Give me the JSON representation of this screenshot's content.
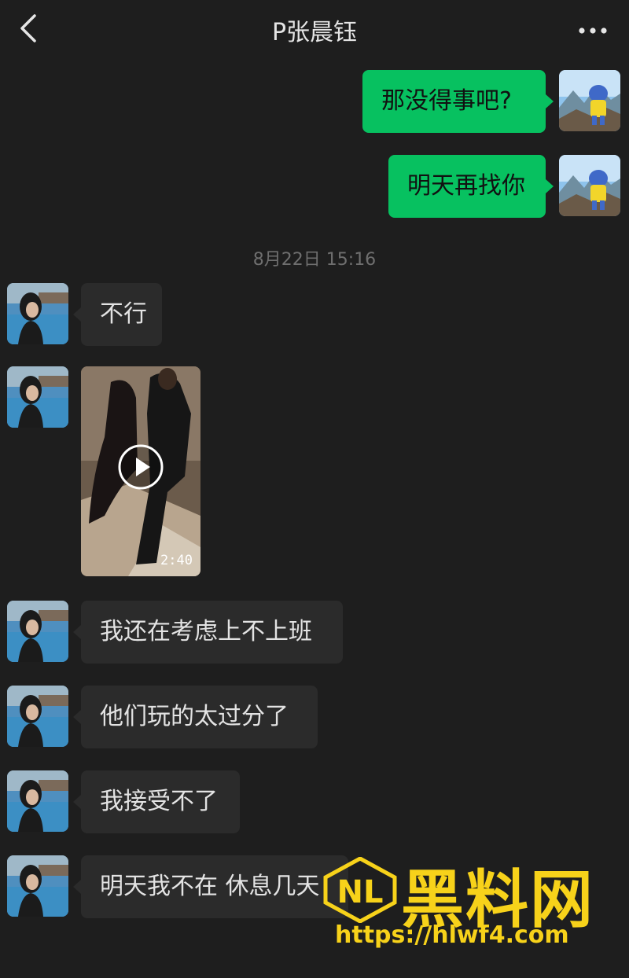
{
  "header": {
    "title": "P张晨钰",
    "back_icon": "chevron-left-icon",
    "more_icon": "more-dots-icon"
  },
  "messages_sent": [
    {
      "text": "那没得事吧?"
    },
    {
      "text": "明天再找你"
    }
  ],
  "timestamp": "8月22日 15:16",
  "messages_received": [
    {
      "text": "不行"
    },
    {
      "type": "video",
      "duration": "2:40"
    },
    {
      "text": "我还在考虑上不上班"
    },
    {
      "text": "他们玩的太过分了"
    },
    {
      "text": "我接受不了"
    },
    {
      "text": "明天我不在 休息几天"
    }
  ],
  "watermark": {
    "brand": "黑料网",
    "url": "https://hlwf4.com"
  },
  "colors": {
    "background": "#1e1e1e",
    "sent_bubble": "#07c160",
    "received_bubble": "#2b2b2b",
    "watermark": "#f7d21a"
  }
}
